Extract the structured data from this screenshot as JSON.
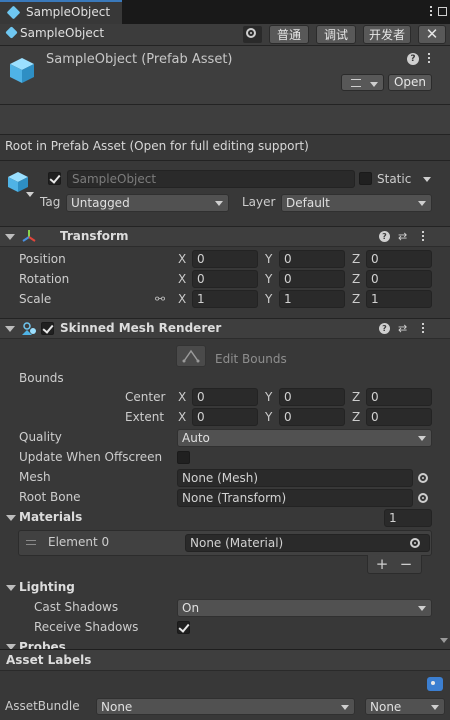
{
  "window": {
    "tab_title": "SampleObject",
    "breadcrumb": "SampleObject"
  },
  "toolbar": {
    "mode_normal": "普通",
    "mode_debug": "调试",
    "mode_developer": "开发者"
  },
  "asset": {
    "title": "SampleObject (Prefab Asset)",
    "open_button": "Open"
  },
  "info": {
    "root_note": "Root in Prefab Asset (Open for full editing support)"
  },
  "gameobject": {
    "name": "SampleObject",
    "static_label": "Static",
    "tag_label": "Tag",
    "tag_value": "Untagged",
    "layer_label": "Layer",
    "layer_value": "Default"
  },
  "transform": {
    "title": "Transform",
    "rows": [
      {
        "label": "Position",
        "x": "0",
        "y": "0",
        "z": "0"
      },
      {
        "label": "Rotation",
        "x": "0",
        "y": "0",
        "z": "0"
      },
      {
        "label": "Scale",
        "x": "1",
        "y": "1",
        "z": "1"
      }
    ]
  },
  "axes": {
    "x": "X",
    "y": "Y",
    "z": "Z"
  },
  "renderer": {
    "title": "Skinned Mesh Renderer",
    "edit_bounds": "Edit Bounds",
    "bounds_label": "Bounds",
    "center_label": "Center",
    "center": {
      "x": "0",
      "y": "0",
      "z": "0"
    },
    "extent_label": "Extent",
    "extent": {
      "x": "0",
      "y": "0",
      "z": "0"
    },
    "quality_label": "Quality",
    "quality_value": "Auto",
    "update_offscreen_label": "Update When Offscreen",
    "mesh_label": "Mesh",
    "mesh_value": "None (Mesh)",
    "root_bone_label": "Root Bone",
    "root_bone_value": "None (Transform)",
    "materials_label": "Materials",
    "materials_count": "1",
    "element_label": "Element 0",
    "element_value": "None (Material)",
    "lighting_label": "Lighting",
    "cast_shadows_label": "Cast Shadows",
    "cast_shadows_value": "On",
    "receive_shadows_label": "Receive Shadows",
    "probes_label": "Probes"
  },
  "footer": {
    "asset_labels": "Asset Labels",
    "assetbundle_label": "AssetBundle",
    "assetbundle_value": "None",
    "variant_value": "None"
  },
  "colors": {
    "cube_icon": "#6fc7f1",
    "background": "#383838",
    "field": "#2a2a2a"
  }
}
